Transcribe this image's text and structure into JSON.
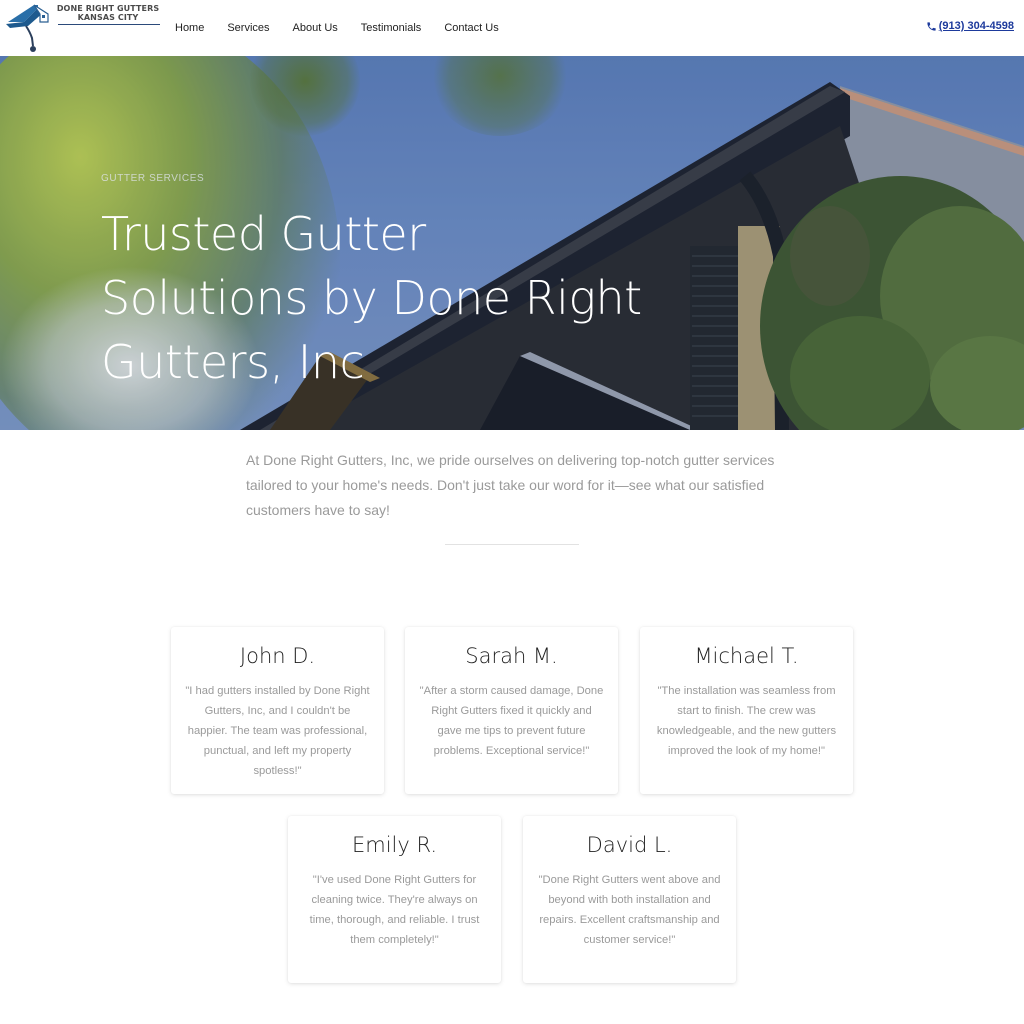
{
  "header": {
    "logo": {
      "line1": "DONE RIGHT GUTTERS",
      "line2": "KANSAS CITY",
      "icon": "house-gutter-logo-icon"
    },
    "nav": [
      {
        "label": "Home"
      },
      {
        "label": "Services"
      },
      {
        "label": "About Us"
      },
      {
        "label": "Testimonials"
      },
      {
        "label": "Contact Us"
      }
    ],
    "phone": {
      "icon": "phone-icon",
      "label": "(913) 304-4598",
      "color": "#1d3a9c"
    }
  },
  "hero": {
    "eyebrow": "GUTTER SERVICES",
    "title_lines": [
      "Trusted Gutter",
      "Solutions by Done Right",
      "Gutters, Inc"
    ]
  },
  "intro": {
    "text": "At Done Right Gutters, Inc, we pride ourselves on delivering top-notch gutter services tailored to your home's needs. Don't just take our word for it—see what our satisfied customers have to say!"
  },
  "testimonials": [
    {
      "name": "John D.",
      "quote": "\"I had gutters installed by Done Right Gutters, Inc, and I couldn't be happier. The team was professional, punctual, and left my property spotless!\""
    },
    {
      "name": "Sarah M.",
      "quote": "\"After a storm caused damage, Done Right Gutters fixed it quickly and gave me tips to prevent future problems. Exceptional service!\""
    },
    {
      "name": "Michael T.",
      "quote": "\"The installation was seamless from start to finish. The crew was knowledgeable, and the new gutters improved the look of my home!\""
    },
    {
      "name": "Emily R.",
      "quote": "\"I've used Done Right Gutters for cleaning twice. They're always on time, thorough, and reliable. I trust them completely!\""
    },
    {
      "name": "David L.",
      "quote": "\"Done Right Gutters went above and beyond with both installation and repairs. Excellent craftsmanship and customer service!\""
    }
  ]
}
